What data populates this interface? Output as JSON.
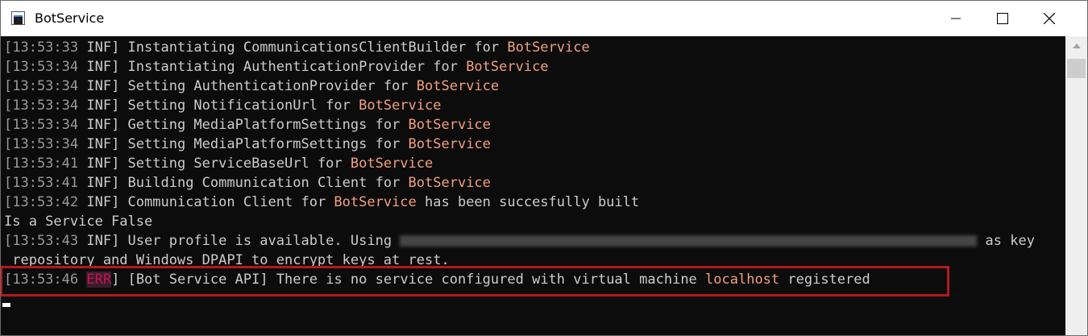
{
  "window": {
    "title": "BotService",
    "icons": {
      "app": "console-app-icon",
      "minimize": "minimize-icon",
      "maximize": "maximize-icon",
      "close": "close-icon"
    }
  },
  "console": {
    "lines": [
      {
        "ts": "[13:53:33",
        "level": " INF]",
        "text": " Instantiating CommunicationsClientBuilder for ",
        "src": "BotService",
        "rest": ""
      },
      {
        "ts": "[13:53:34",
        "level": " INF]",
        "text": " Instantiating AuthenticationProvider for ",
        "src": "BotService",
        "rest": ""
      },
      {
        "ts": "[13:53:34",
        "level": " INF]",
        "text": " Setting AuthenticationProvider for ",
        "src": "BotService",
        "rest": ""
      },
      {
        "ts": "[13:53:34",
        "level": " INF]",
        "text": " Setting NotificationUrl for ",
        "src": "BotService",
        "rest": ""
      },
      {
        "ts": "[13:53:34",
        "level": " INF]",
        "text": " Getting MediaPlatformSettings for ",
        "src": "BotService",
        "rest": ""
      },
      {
        "ts": "[13:53:34",
        "level": " INF]",
        "text": " Setting MediaPlatformSettings for ",
        "src": "BotService",
        "rest": ""
      },
      {
        "ts": "[13:53:41",
        "level": " INF]",
        "text": " Setting ServiceBaseUrl for ",
        "src": "BotService",
        "rest": ""
      },
      {
        "ts": "[13:53:41",
        "level": " INF]",
        "text": " Building Communication Client for ",
        "src": "BotService",
        "rest": ""
      },
      {
        "ts": "[13:53:42",
        "level": " INF]",
        "text": " Communication Client for ",
        "src": "BotService",
        "rest": " has been succesfully built"
      }
    ],
    "plain_line": "Is a Service False",
    "profile_line": {
      "ts": "[13:53:43",
      "level": " INF]",
      "text": " User profile is available. Using ",
      "after": " as key"
    },
    "wrap_line": " repository and Windows DPAPI to encrypt keys at rest.",
    "error_line": {
      "ts": "[13:53:46",
      "err": "ERR",
      "close": "]",
      "text": " [Bot Service API] There is no service configured with virtual machine ",
      "host": "localhost",
      "rest": " registered"
    }
  },
  "colors": {
    "background": "#0c0c0c",
    "text": "#cccccc",
    "timestamp": "#9a9a9a",
    "source_highlight": "#f3a07e",
    "error_level": "#c4144f",
    "highlight_box": "#b3191f"
  }
}
